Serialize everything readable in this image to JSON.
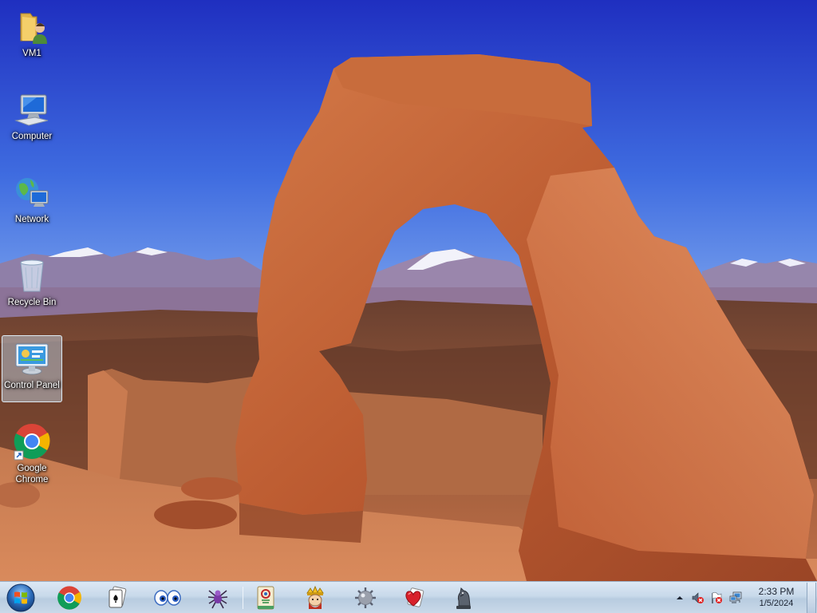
{
  "desktop": {
    "icons": [
      {
        "label": "VM1",
        "icon": "user-folder-icon"
      },
      {
        "label": "Computer",
        "icon": "computer-icon"
      },
      {
        "label": "Network",
        "icon": "network-icon"
      },
      {
        "label": "Recycle Bin",
        "icon": "recycle-bin-icon"
      },
      {
        "label": "Control Panel",
        "icon": "control-panel-icon",
        "selected": true
      },
      {
        "label": "Google\nChrome",
        "icon": "chrome-icon"
      }
    ],
    "wallpaper": "delicate-arch-wallpaper"
  },
  "taskbar": {
    "start_icon": "windows-start-icon",
    "pinned": [
      {
        "name": "chrome",
        "icon": "chrome-icon"
      },
      {
        "name": "solitaire",
        "icon": "solitaire-icon"
      },
      {
        "name": "purble-place",
        "icon": "purble-eyes-icon"
      },
      {
        "name": "spider-solitaire",
        "icon": "spider-icon"
      },
      {
        "name": "mahjong",
        "icon": "mahjong-icon"
      },
      {
        "name": "freecell",
        "icon": "freecell-king-icon"
      },
      {
        "name": "minesweeper",
        "icon": "mine-icon"
      },
      {
        "name": "hearts",
        "icon": "hearts-icon"
      },
      {
        "name": "chess",
        "icon": "chess-knight-icon"
      }
    ],
    "tray": {
      "icons": [
        "show-hidden-icons-arrow",
        "volume-muted-icon",
        "action-center-flag-icon",
        "network-disconnected-icon"
      ],
      "time": "2:33 PM",
      "date": "1/5/2024"
    },
    "colors": {
      "accent": "#2b6cc4"
    }
  }
}
